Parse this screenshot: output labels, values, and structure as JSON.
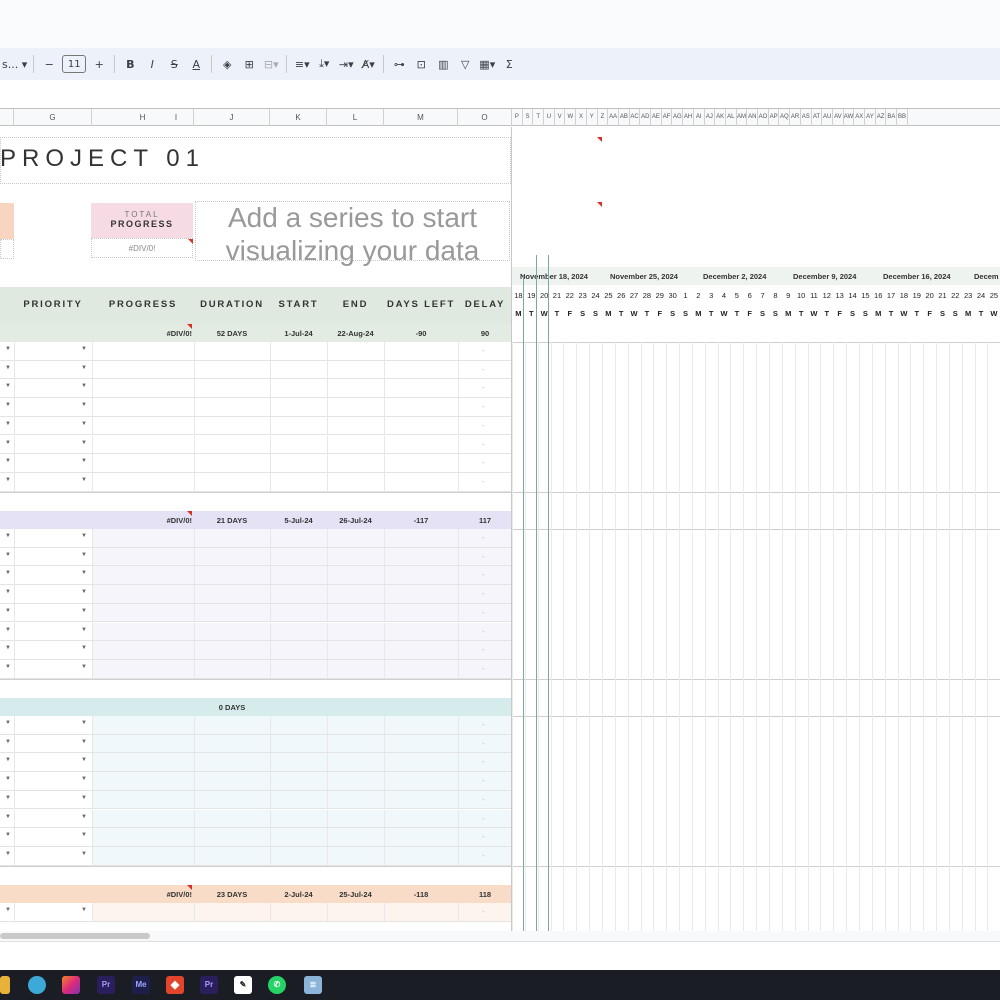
{
  "toolbar": {
    "font_name": "s...",
    "font_size": "11",
    "bold": "B",
    "italic": "I",
    "strikethrough": "S",
    "text_color": "A",
    "sum": "Σ"
  },
  "columns": [
    "G",
    "H",
    "I",
    "J",
    "K",
    "L",
    "M",
    "O",
    "P",
    "S",
    "T",
    "U",
    "V",
    "W",
    "X",
    "Y",
    "Z",
    "AA",
    "AB",
    "AC",
    "AD",
    "AE",
    "AF",
    "AG",
    "AH",
    "AI",
    "AJ",
    "AK",
    "AL",
    "AM",
    "AN",
    "AO",
    "AP",
    "AQ",
    "AR",
    "AS",
    "AT",
    "AU",
    "AV",
    "AW",
    "AX",
    "AY",
    "AZ",
    "BA",
    "BB"
  ],
  "project_title": "PROJECT 01",
  "total_progress": {
    "line1": "TOTAL",
    "line2": "PROGRESS",
    "value": "#DIV/0!"
  },
  "chart_placeholder": {
    "line1": "Add a series to start",
    "line2": "visualizing your data"
  },
  "headers": [
    "PRIORITY",
    "PROGRESS",
    "DURATION",
    "START",
    "END",
    "DAYS LEFT",
    "DELAY"
  ],
  "weeks": [
    "November 18, 2024",
    "November 25, 2024",
    "December 2, 2024",
    "December 9, 2024",
    "December 16, 2024",
    "Decem"
  ],
  "days": [
    "18",
    "19",
    "20",
    "21",
    "22",
    "23",
    "24",
    "25",
    "26",
    "27",
    "28",
    "29",
    "30",
    "1",
    "2",
    "3",
    "4",
    "5",
    "6",
    "7",
    "8",
    "9",
    "10",
    "11",
    "12",
    "13",
    "14",
    "15",
    "16",
    "17",
    "18",
    "19",
    "20",
    "21",
    "22",
    "23",
    "24",
    "25"
  ],
  "day_letters": [
    "M",
    "T",
    "W",
    "T",
    "F",
    "S",
    "S",
    "M",
    "T",
    "W",
    "T",
    "F",
    "S",
    "S",
    "M",
    "T",
    "W",
    "T",
    "F",
    "S",
    "S",
    "M",
    "T",
    "W",
    "T",
    "F",
    "S",
    "S",
    "M",
    "T",
    "W",
    "T",
    "F",
    "S",
    "S",
    "M",
    "T",
    "W"
  ],
  "sections": [
    {
      "progress": "#DIV/0!",
      "duration": "52 DAYS",
      "start": "1-Jul-24",
      "end": "22-Aug-24",
      "days_left": "-90",
      "delay": "90",
      "color": "#e2ece3",
      "tint": "#ffffff"
    },
    {
      "progress": "#DIV/0!",
      "duration": "21 DAYS",
      "start": "5-Jul-24",
      "end": "26-Jul-24",
      "days_left": "-117",
      "delay": "117",
      "color": "#e4e2f4",
      "tint": "#f6f5fc"
    },
    {
      "progress": "",
      "duration": "0 DAYS",
      "start": "",
      "end": "",
      "days_left": "",
      "delay": "",
      "color": "#d6ecec",
      "tint": "#f1f8fb"
    },
    {
      "progress": "#DIV/0!",
      "duration": "23 DAYS",
      "start": "2-Jul-24",
      "end": "25-Jul-24",
      "days_left": "-118",
      "delay": "118",
      "color": "#f8dcc8",
      "tint": "#fdf4ee"
    }
  ],
  "row_placeholder": "-",
  "taskbar": [
    "Pr",
    "Me",
    "Pr"
  ]
}
